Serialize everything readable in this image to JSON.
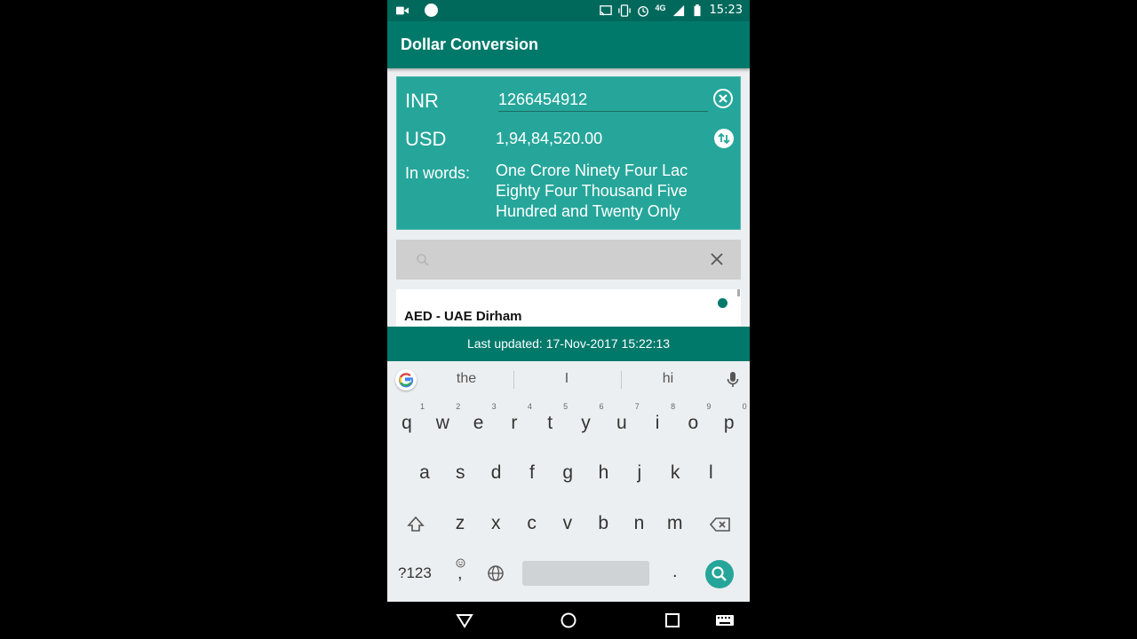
{
  "status_bar": {
    "time": "15:23",
    "network": "4G",
    "icons": [
      "video-camera-icon",
      "record-dot-icon",
      "cast-icon",
      "vibrate-icon",
      "alarm-icon",
      "signal-icon",
      "battery-icon"
    ]
  },
  "app": {
    "title": "Dollar Conversion"
  },
  "converter": {
    "from_currency": "INR",
    "from_amount": "1266454912",
    "to_currency": "USD",
    "to_amount": "1,94,84,520.00",
    "in_words_label": "In words:",
    "in_words_value": "One Crore Ninety Four Lac Eighty Four Thousand Five Hundred and Twenty Only"
  },
  "search": {
    "placeholder": "",
    "value": ""
  },
  "currency_list": [
    {
      "label": "AED - UAE Dirham",
      "selected": true
    }
  ],
  "footer": {
    "last_updated": "Last updated: 17-Nov-2017 15:22:13"
  },
  "keyboard": {
    "suggestions": [
      "the",
      "I",
      "hi"
    ],
    "row1": [
      {
        "k": "q",
        "h": "1"
      },
      {
        "k": "w",
        "h": "2"
      },
      {
        "k": "e",
        "h": "3"
      },
      {
        "k": "r",
        "h": "4"
      },
      {
        "k": "t",
        "h": "5"
      },
      {
        "k": "y",
        "h": "6"
      },
      {
        "k": "u",
        "h": "7"
      },
      {
        "k": "i",
        "h": "8"
      },
      {
        "k": "o",
        "h": "9"
      },
      {
        "k": "p",
        "h": "0"
      }
    ],
    "row2": [
      "a",
      "s",
      "d",
      "f",
      "g",
      "h",
      "j",
      "k",
      "l"
    ],
    "row3": [
      "z",
      "x",
      "c",
      "v",
      "b",
      "n",
      "m"
    ],
    "symbols_key": "?123",
    "comma_key": ",",
    "period_key": "."
  },
  "colors": {
    "primary_dark": "#00695c",
    "primary": "#00796b",
    "card": "#26a69a"
  }
}
